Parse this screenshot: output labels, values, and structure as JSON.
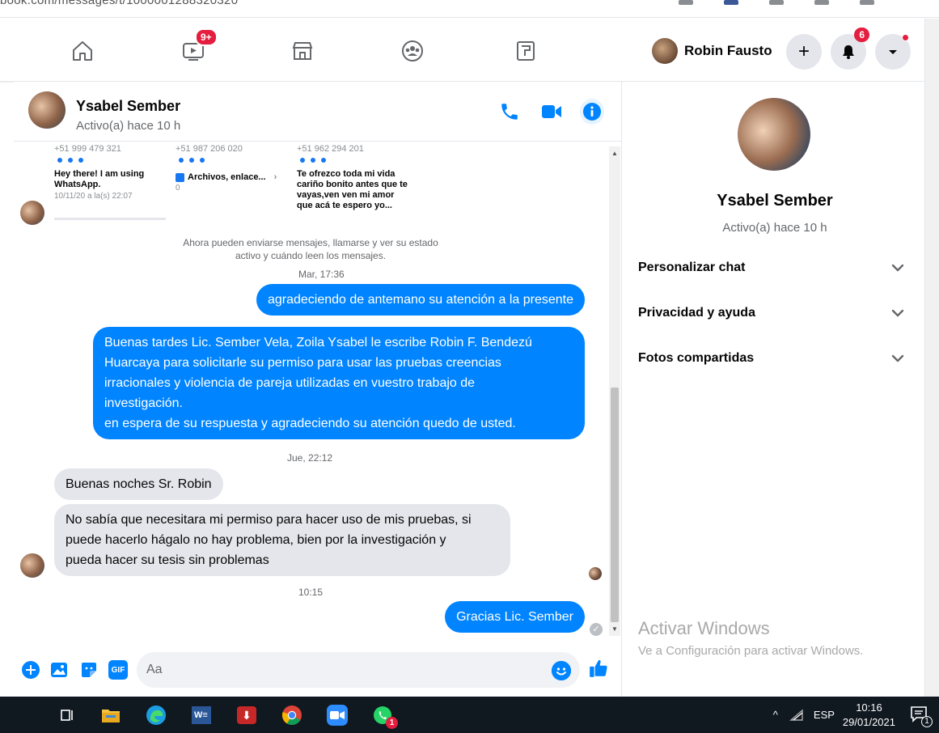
{
  "browser": {
    "url_fragment": "book.com/messages/t/1000001288320320"
  },
  "topnav": {
    "watch_badge": "9+",
    "profile_name": "Robin Fausto",
    "create_label": "+",
    "notifications_badge": "6"
  },
  "chat": {
    "contact_name": "Ysabel Sember",
    "contact_status": "Activo(a) hace 10 h",
    "contact_cards": [
      {
        "phone": "+51 999 479 321",
        "title": "Hey there! I am using WhatsApp.",
        "sub": "10/11/20 a la(s) 22:07"
      },
      {
        "phone": "+51 987 206 020",
        "title": "Archivos, enlace...",
        "sub": "0"
      },
      {
        "phone": "+51 962 294 201",
        "title": "Te ofrezco toda mi vida cariño bonito antes que te vayas,ven ven mi amor que acá te espero yo..."
      }
    ],
    "system_note": "Ahora pueden enviarse mensajes, llamarse y ver su estado activo y cuándo leen los mensajes.",
    "messages": [
      {
        "type": "timestamp",
        "text": "Mar, 17:36"
      },
      {
        "type": "out",
        "text": "agradeciendo de antemano su atención a la presente"
      },
      {
        "type": "out",
        "lines": [
          "Buenas tardes Lic. Sember Vela, Zoila Ysabel le escribe Robin F. Bendezú",
          "Huarcaya para solicitarle su permiso para usar las pruebas creencias",
          "irracionales y violencia de pareja utilizadas en vuestro trabajo de",
          "investigación.",
          "en espera de su respuesta y agradeciendo su atención quedo de usted."
        ]
      },
      {
        "type": "timestamp",
        "text": "Jue, 22:12"
      },
      {
        "type": "in",
        "text": "Buenas noches Sr. Robin"
      },
      {
        "type": "in",
        "lines": [
          "No sabía que necesitara mi permiso para hacer uso de mis pruebas, si",
          "puede hacerlo hágalo no hay problema, bien por la investigación y",
          "pueda hacer su tesis sin problemas"
        ]
      },
      {
        "type": "timestamp",
        "text": "10:15"
      },
      {
        "type": "out",
        "text": "Gracias Lic. Sember"
      }
    ],
    "composer_placeholder": "Aa",
    "gif_label": "GIF"
  },
  "info_panel": {
    "name": "Ysabel Sember",
    "status": "Activo(a) hace 10 h",
    "sections": [
      "Personalizar chat",
      "Privacidad y ayuda",
      "Fotos compartidas"
    ],
    "activate_title": "Activar Windows",
    "activate_sub": "Ve a Configuración para activar Windows."
  },
  "taskbar": {
    "language": "ESP",
    "time": "10:16",
    "date": "29/01/2021",
    "notif_count": "1",
    "whatsapp_badge": "1"
  },
  "colors": {
    "messenger_blue": "#0084ff",
    "fb_blue": "#1877f2",
    "badge_red": "#e41e3f",
    "incoming_gray": "#e4e6eb"
  }
}
